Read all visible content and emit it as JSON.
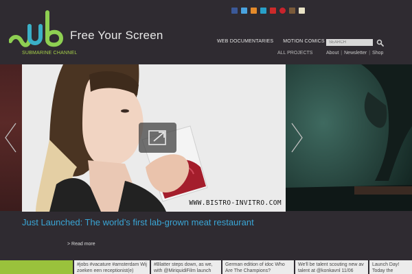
{
  "brand": {
    "tagline": "Free Your Screen",
    "sub_label": "SUBMARINE CHANNEL",
    "logo_color": "#8ecf52",
    "logo_accent": "#3ab0c8"
  },
  "social": [
    {
      "name": "facebook-icon",
      "color": "#3b5998"
    },
    {
      "name": "twitter-icon",
      "color": "#4aa3df"
    },
    {
      "name": "rss-icon",
      "color": "#e58a2a"
    },
    {
      "name": "vimeo-icon",
      "color": "#28a0c8"
    },
    {
      "name": "youtube-icon",
      "color": "#cc2a2a"
    },
    {
      "name": "pinterest-icon",
      "color": "#c8232c"
    },
    {
      "name": "instagram-icon",
      "color": "#7a5a3a"
    },
    {
      "name": "email-icon",
      "color": "#e9e3c6"
    }
  ],
  "nav": {
    "web_documentaries": "WEB DOCUMENTARIES",
    "motion_comics": "MOTION COMICS",
    "all_projects": "ALL PROJECTS"
  },
  "search": {
    "placeholder": "SEARCH"
  },
  "util": {
    "about": "About",
    "newsletter": "Newsletter",
    "shop": "Shop",
    "sep": "|"
  },
  "hero": {
    "caption": "WWW.BISTRO-INVITRO.COM",
    "headline": "Just Launched: The world’s first lab-grown meat restaurant",
    "read_more": "> Read more"
  },
  "ticker": [
    "#jobs #vacature #amsterdam Wij zoeken een receptionist(e)",
    "#Blatter steps down, as we, with @MiriquidiFilm launch the",
    "German edition of idoc Who Are The Champions? launched!",
    "We'll be talent scouting new av talent at @konkavnl 11/06",
    "Launch Day! Today the German edition"
  ],
  "colors": {
    "background": "#2f2b31",
    "headline": "#3aa6d6",
    "accent_green": "#9ac23c"
  }
}
